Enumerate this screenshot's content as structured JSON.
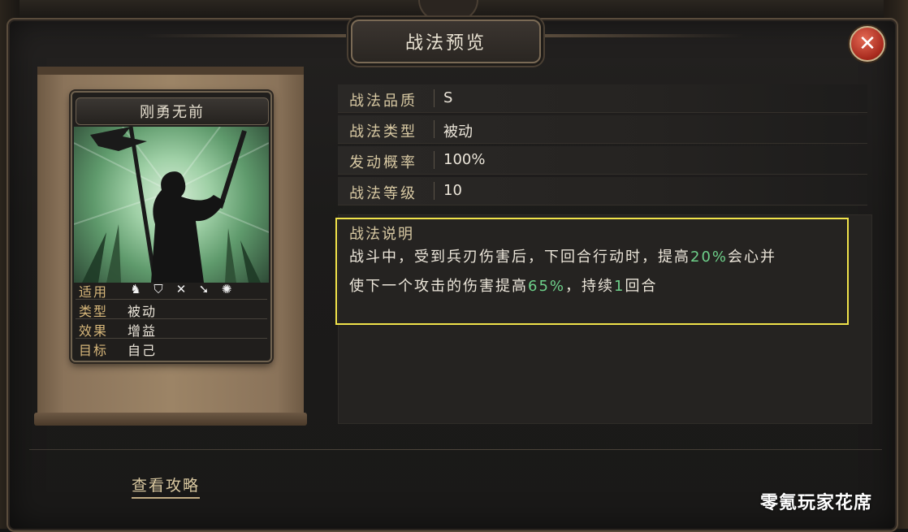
{
  "window": {
    "title": "战法预览",
    "close_label": "✕"
  },
  "card": {
    "name": "刚勇无前",
    "stats": [
      {
        "key": "适用",
        "icons": [
          "cavalry-icon",
          "shield-icon",
          "crossbow-icon",
          "spear-icon",
          "wheel-icon"
        ]
      },
      {
        "key": "类型",
        "value": "被动"
      },
      {
        "key": "效果",
        "value": "增益"
      },
      {
        "key": "目标",
        "value": "自己"
      }
    ]
  },
  "info": {
    "rows": [
      {
        "key": "战法品质",
        "value": "S"
      },
      {
        "key": "战法类型",
        "value": "被动"
      },
      {
        "key": "发动概率",
        "value": "100%"
      },
      {
        "key": "战法等级",
        "value": "10"
      }
    ]
  },
  "description": {
    "title": "战法说明",
    "line1_a": "战斗中，受到兵刃伤害后，下回合行动时，提高",
    "line1_b": "20%",
    "line1_c": "会心并",
    "line2_a": "使下一个攻击的伤害提高",
    "line2_b": "65%",
    "line2_c": "，持续",
    "line2_d": "1",
    "line2_e": "回合"
  },
  "footer": {
    "guide_link": "查看攻略",
    "watermark": "零氪玩家花席"
  },
  "colors": {
    "highlight": "#6ed08a",
    "frame_highlight": "#f0e24a",
    "label_gold": "#d7b77a"
  }
}
